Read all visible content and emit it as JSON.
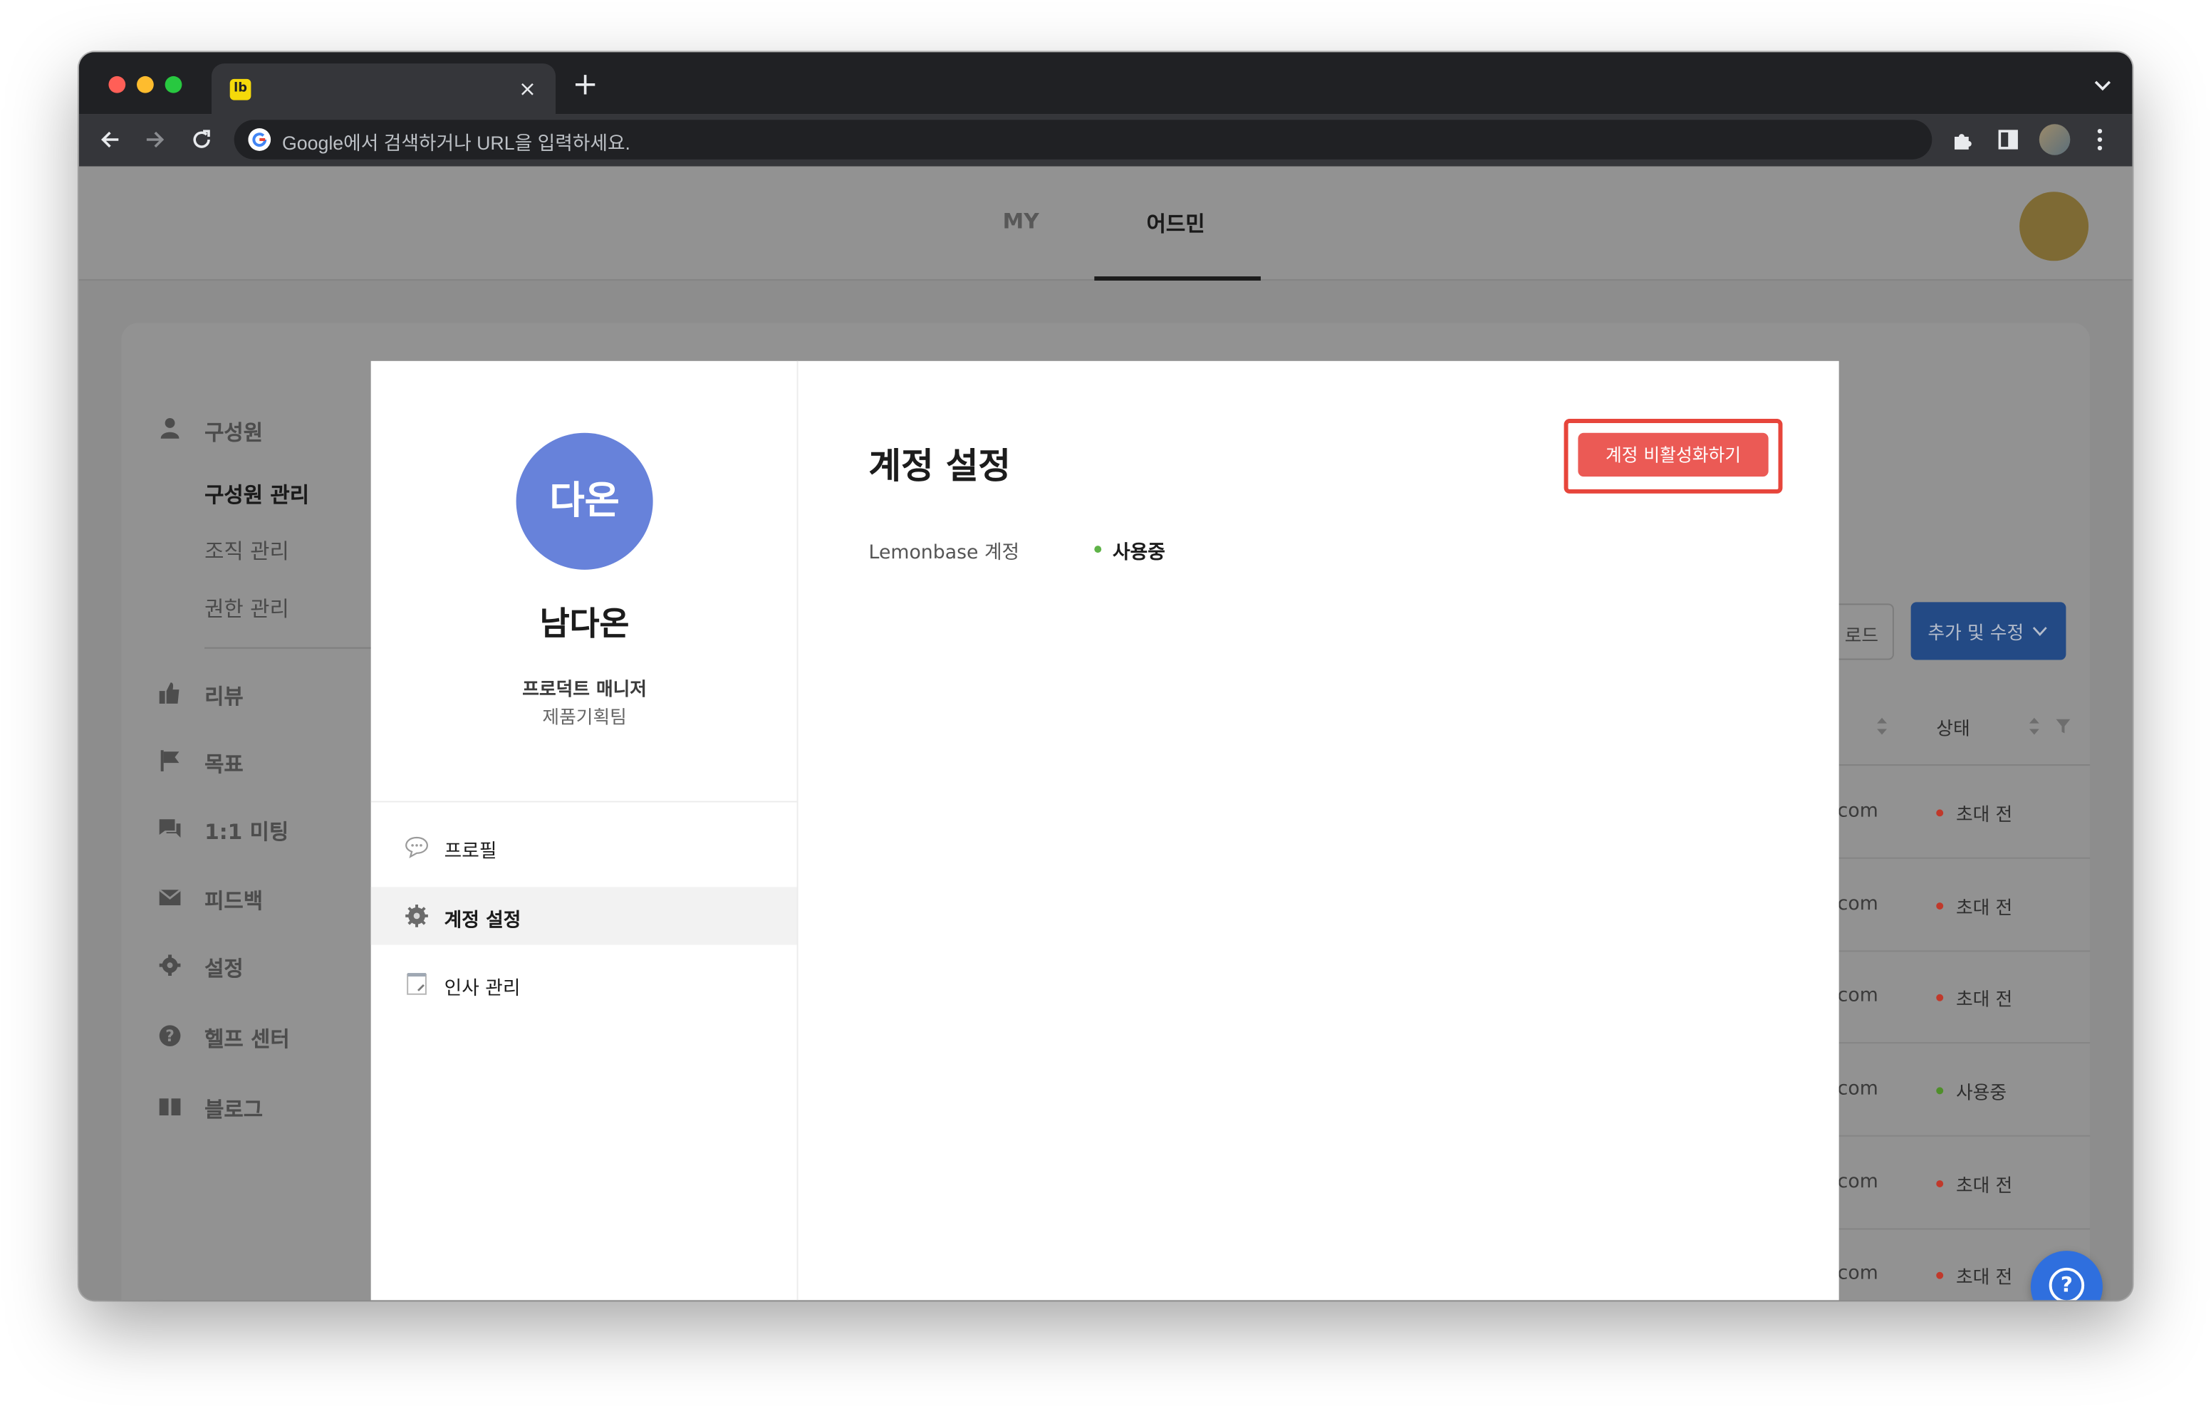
{
  "browser": {
    "tab_favicon_text": "lb",
    "tab_close_glyph": "×",
    "new_tab_glyph": "+",
    "omnibox_placeholder": "Google에서 검색하거나 URL을 입력하세요."
  },
  "header": {
    "tabs": [
      {
        "label": "MY",
        "active": false
      },
      {
        "label": "어드민",
        "active": true
      }
    ]
  },
  "sidebar": {
    "sections": [
      {
        "label": "구성원",
        "icon": "person-icon"
      },
      {
        "label": "리뷰",
        "icon": "thumbs-up-icon"
      },
      {
        "label": "목표",
        "icon": "flag-icon"
      },
      {
        "label": "1:1 미팅",
        "icon": "chat-icon"
      },
      {
        "label": "피드백",
        "icon": "mail-icon"
      },
      {
        "label": "설정",
        "icon": "gear-icon"
      },
      {
        "label": "헬프 센터",
        "icon": "help-circle-icon"
      },
      {
        "label": "블로그",
        "icon": "book-icon"
      }
    ],
    "sub_items": [
      {
        "label": "구성원 관리",
        "selected": true
      },
      {
        "label": "조직 관리",
        "selected": false
      },
      {
        "label": "권한 관리",
        "selected": false
      }
    ]
  },
  "background_table": {
    "partial_button_label": "로드",
    "add_edit_button_label": "추가 및 수정",
    "status_header": "상태",
    "rows": [
      {
        "email_fragment": "com",
        "status": "초대 전",
        "status_color": "#c0392b"
      },
      {
        "email_fragment": "com",
        "status": "초대 전",
        "status_color": "#c0392b"
      },
      {
        "email_fragment": "com",
        "status": "초대 전",
        "status_color": "#c0392b"
      },
      {
        "email_fragment": "com",
        "status": "사용중",
        "status_color": "#4f8f2a"
      },
      {
        "email_fragment": "com",
        "status": "초대 전",
        "status_color": "#c0392b"
      },
      {
        "email_fragment": "com",
        "status": "초대 전",
        "status_color": "#c0392b"
      }
    ],
    "help_glyph": "?"
  },
  "modal": {
    "profile": {
      "avatar_text": "다온",
      "name": "남다온",
      "role": "프로덕트 매니저",
      "team": "제품기획팀"
    },
    "menu": [
      {
        "label": "프로필",
        "icon": "speech-bubble-icon",
        "active": false
      },
      {
        "label": "계정 설정",
        "icon": "gear-icon",
        "active": true
      },
      {
        "label": "인사 관리",
        "icon": "notepad-icon",
        "active": false
      }
    ],
    "title": "계정 설정",
    "deactivate_button": "계정 비활성화하기",
    "account_field": {
      "label": "Lemonbase 계정",
      "value": "사용중",
      "status_color": "#5fb348"
    }
  },
  "colors": {
    "accent_blue": "#6782da",
    "danger_red": "#eb5a55",
    "highlight_red": "#e7453b",
    "primary_button": "#234a85"
  }
}
